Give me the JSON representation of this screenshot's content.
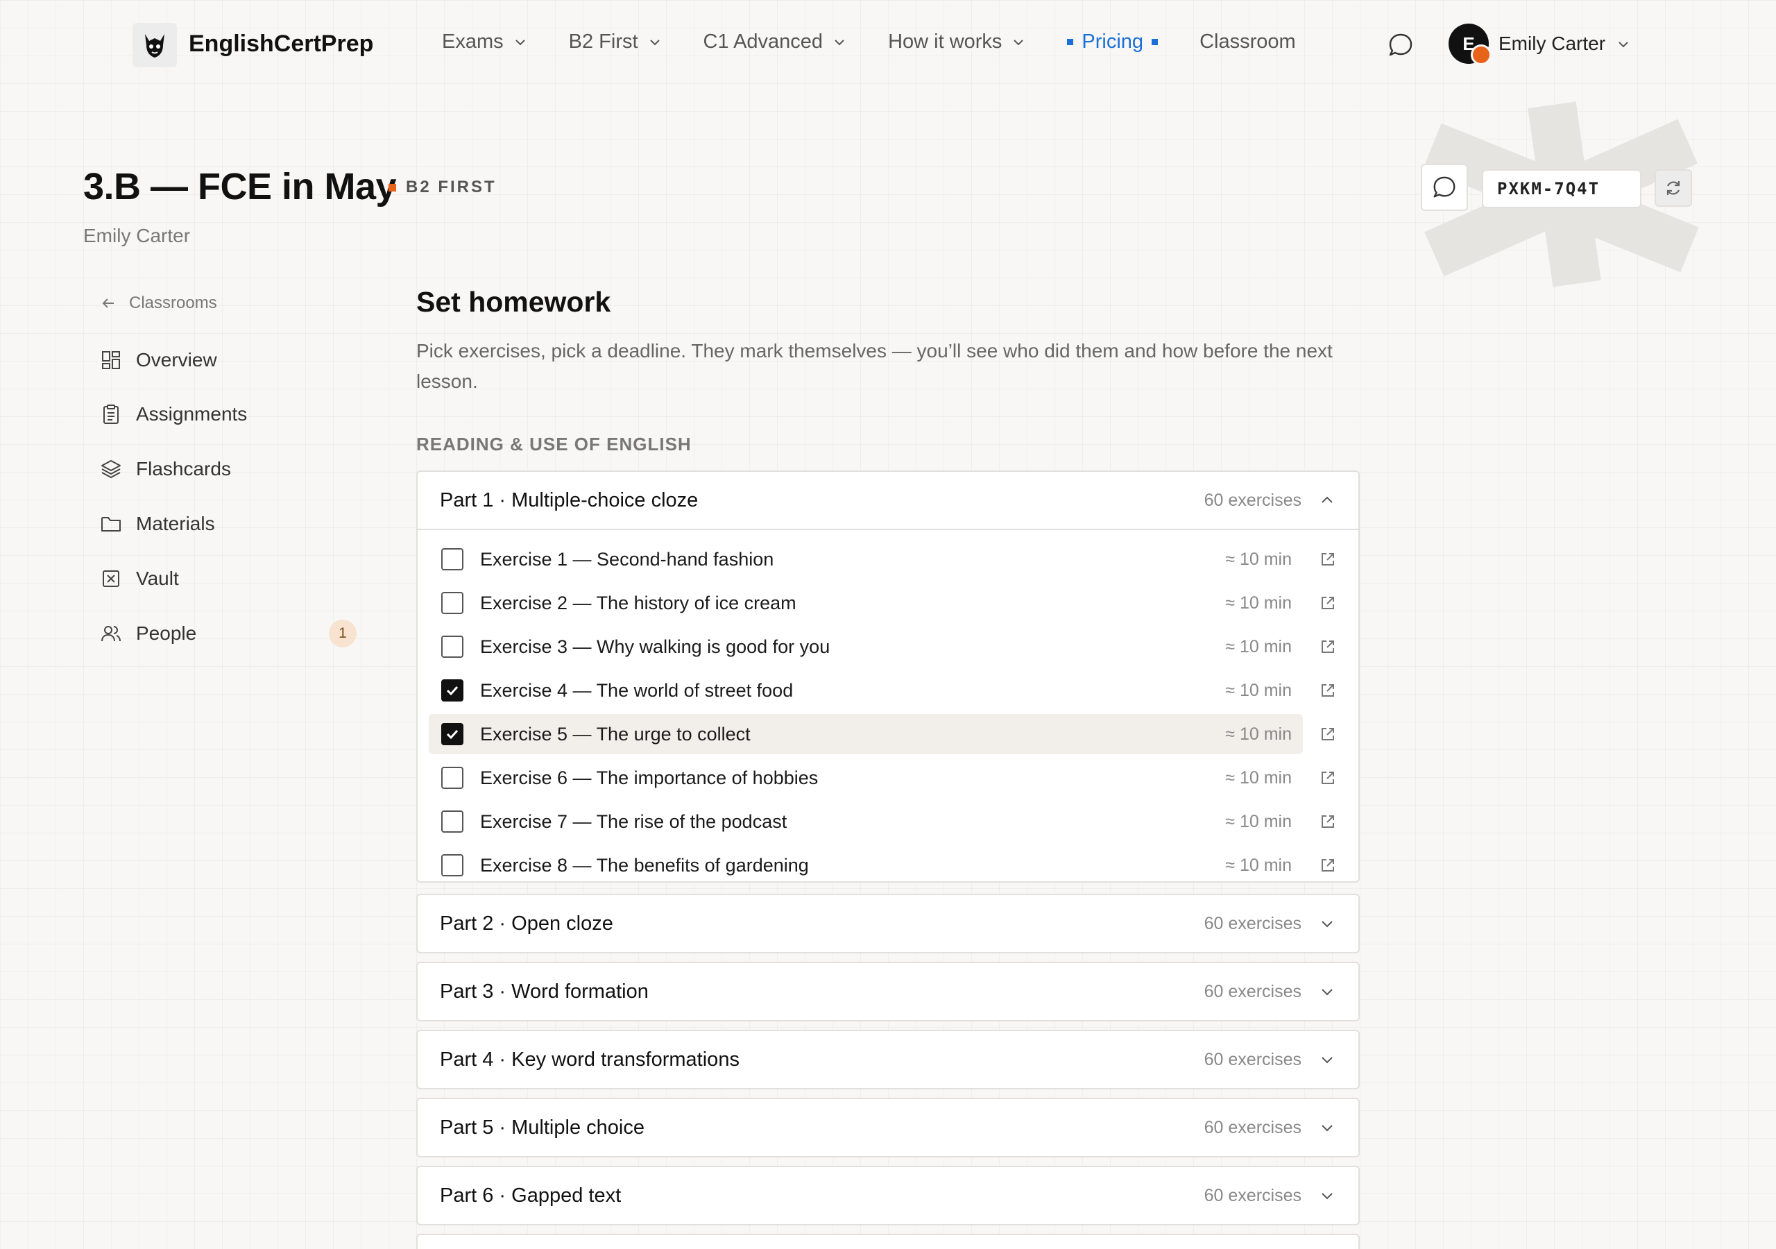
{
  "header": {
    "brand": "EnglishCertPrep",
    "nav": [
      {
        "label": "Exams",
        "dropdown": true,
        "active": false
      },
      {
        "label": "B2 First",
        "dropdown": true,
        "active": false
      },
      {
        "label": "C1 Advanced",
        "dropdown": true,
        "active": false
      },
      {
        "label": "How it works",
        "dropdown": true,
        "active": false
      },
      {
        "label": "Pricing",
        "dropdown": false,
        "active": true
      },
      {
        "label": "Classroom",
        "dropdown": false,
        "active": false
      }
    ],
    "user": {
      "initial": "E",
      "name": "Emily Carter"
    }
  },
  "classroom": {
    "title": "3.B — FCE in May",
    "level": "B2 FIRST",
    "teacher": "Emily Carter",
    "join_code": "PXKM-7Q4T"
  },
  "sidebar": {
    "back_label": "Classrooms",
    "items": [
      {
        "label": "Overview",
        "icon": "grid-icon"
      },
      {
        "label": "Assignments",
        "icon": "clipboard-icon"
      },
      {
        "label": "Flashcards",
        "icon": "layers-icon"
      },
      {
        "label": "Materials",
        "icon": "folder-icon"
      },
      {
        "label": "Vault",
        "icon": "box-x-icon"
      },
      {
        "label": "People",
        "icon": "users-icon",
        "badge": "1"
      }
    ]
  },
  "main": {
    "title": "Set homework",
    "description": "Pick exercises, pick a deadline. They mark themselves — you’ll see who did them and how before the next lesson.",
    "section_label": "READING & USE OF ENGLISH",
    "parts": [
      {
        "title": "Part 1 · Multiple-choice cloze",
        "count": "60 exercises",
        "expanded": true,
        "exercises": [
          {
            "label": "Exercise 1 — Second-hand fashion",
            "time": "≈ 10 min",
            "checked": false
          },
          {
            "label": "Exercise 2 — The history of ice cream",
            "time": "≈ 10 min",
            "checked": false
          },
          {
            "label": "Exercise 3 — Why walking is good for you",
            "time": "≈ 10 min",
            "checked": false
          },
          {
            "label": "Exercise 4 — The world of street food",
            "time": "≈ 10 min",
            "checked": true
          },
          {
            "label": "Exercise 5 — The urge to collect",
            "time": "≈ 10 min",
            "checked": true,
            "highlighted": true
          },
          {
            "label": "Exercise 6 — The importance of hobbies",
            "time": "≈ 10 min",
            "checked": false
          },
          {
            "label": "Exercise 7 — The rise of the podcast",
            "time": "≈ 10 min",
            "checked": false
          },
          {
            "label": "Exercise 8 — The benefits of gardening",
            "time": "≈ 10 min",
            "checked": false
          }
        ]
      },
      {
        "title": "Part 2 · Open cloze",
        "count": "60 exercises",
        "expanded": false
      },
      {
        "title": "Part 3 · Word formation",
        "count": "60 exercises",
        "expanded": false
      },
      {
        "title": "Part 4 · Key word transformations",
        "count": "60 exercises",
        "expanded": false
      },
      {
        "title": "Part 5 · Multiple choice",
        "count": "60 exercises",
        "expanded": false
      },
      {
        "title": "Part 6 · Gapped text",
        "count": "60 exercises",
        "expanded": false
      }
    ]
  },
  "colors": {
    "accent_blue": "#1a6fd8",
    "accent_orange": "#e8631a",
    "background": "#f8f7f5"
  }
}
